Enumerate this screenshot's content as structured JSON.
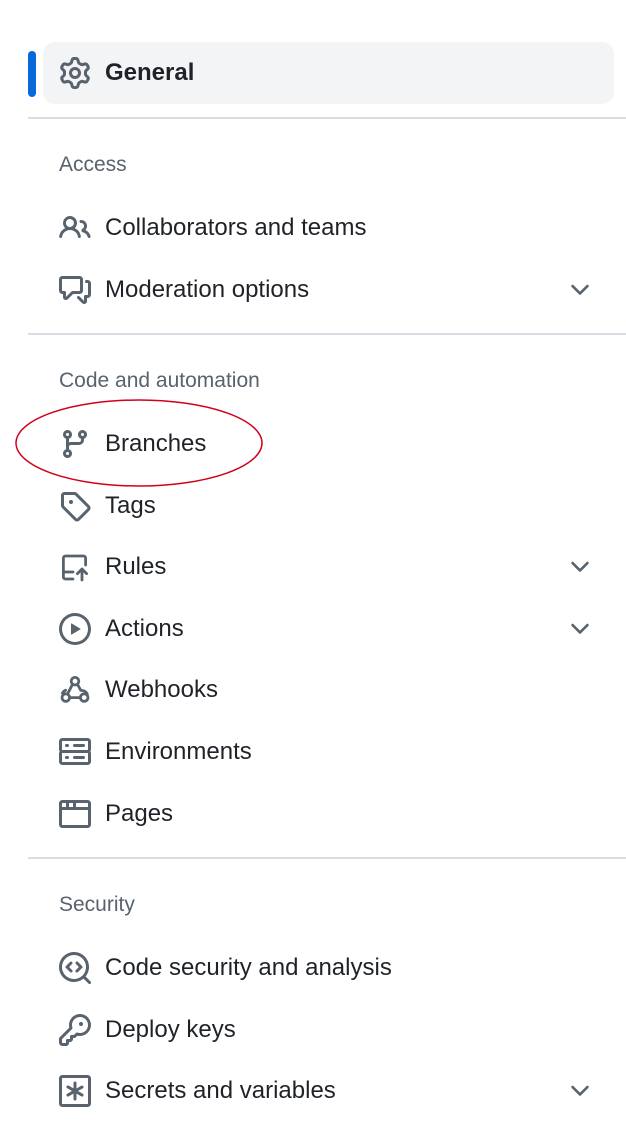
{
  "nav": {
    "general": {
      "label": "General",
      "icon": "gear-icon",
      "active": true
    },
    "sections": [
      {
        "title": "Access",
        "items": [
          {
            "label": "Collaborators and teams",
            "icon": "people-icon",
            "expandable": false
          },
          {
            "label": "Moderation options",
            "icon": "comment-discussion-icon",
            "expandable": true
          }
        ]
      },
      {
        "title": "Code and automation",
        "items": [
          {
            "label": "Branches",
            "icon": "git-branch-icon",
            "expandable": false
          },
          {
            "label": "Tags",
            "icon": "tag-icon",
            "expandable": false
          },
          {
            "label": "Rules",
            "icon": "repo-push-icon",
            "expandable": true
          },
          {
            "label": "Actions",
            "icon": "play-icon",
            "expandable": true
          },
          {
            "label": "Webhooks",
            "icon": "webhook-icon",
            "expandable": false
          },
          {
            "label": "Environments",
            "icon": "server-icon",
            "expandable": false
          },
          {
            "label": "Pages",
            "icon": "browser-icon",
            "expandable": false
          }
        ]
      },
      {
        "title": "Security",
        "items": [
          {
            "label": "Code security and analysis",
            "icon": "codescan-icon",
            "expandable": false
          },
          {
            "label": "Deploy keys",
            "icon": "key-icon",
            "expandable": false
          },
          {
            "label": "Secrets and variables",
            "icon": "key-asterisk-icon",
            "expandable": true
          }
        ]
      }
    ]
  },
  "colors": {
    "accent": "#0969da",
    "annotation": "#d0021b",
    "muted_text": "#59636e",
    "active_bg": "#f3f4f6",
    "divider": "#d8dee4"
  }
}
